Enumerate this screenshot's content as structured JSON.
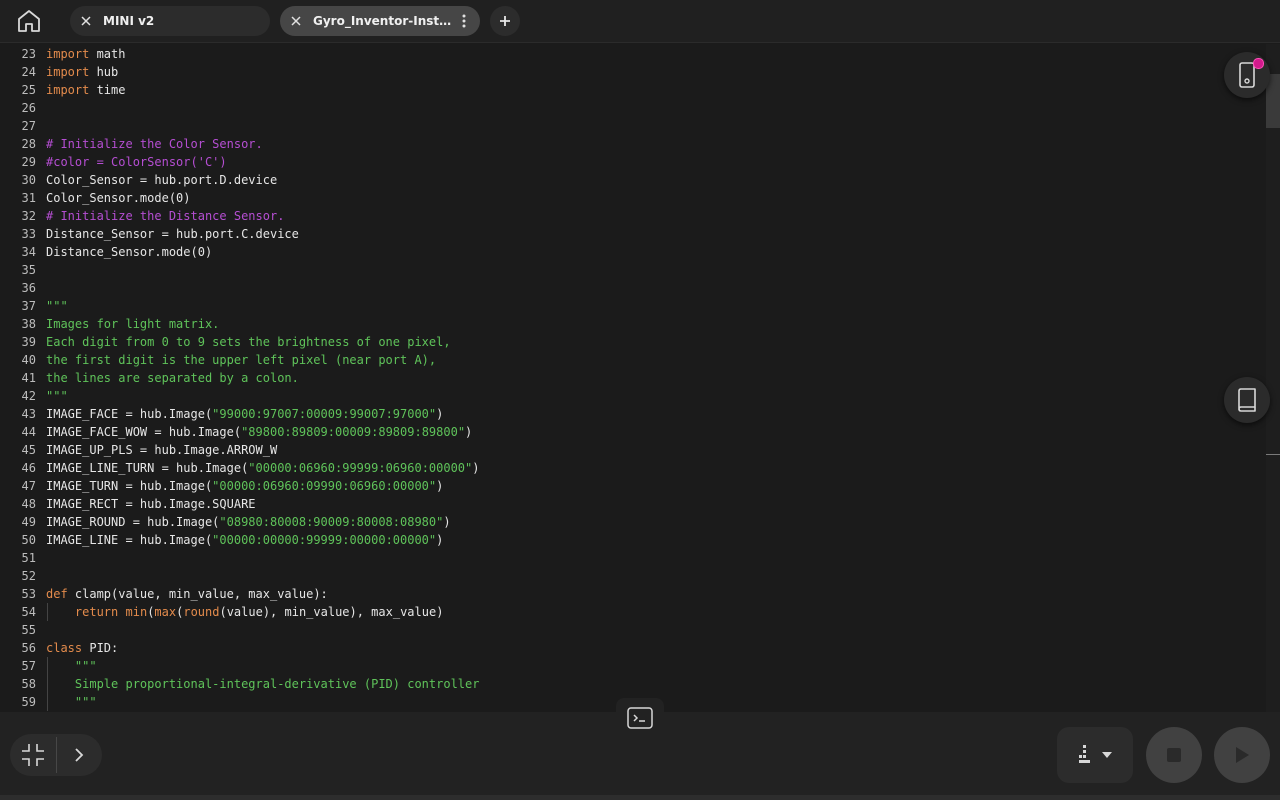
{
  "tabs": [
    {
      "label": "MINI v2",
      "active": false
    },
    {
      "label": "Gyro_Inventor-Instr...",
      "active": true
    }
  ],
  "code": {
    "lines": [
      {
        "n": "23",
        "tokens": [
          {
            "t": "k",
            "v": "import"
          },
          {
            "t": "n",
            "v": " math"
          }
        ]
      },
      {
        "n": "24",
        "tokens": [
          {
            "t": "k",
            "v": "import"
          },
          {
            "t": "n",
            "v": " hub"
          }
        ]
      },
      {
        "n": "25",
        "tokens": [
          {
            "t": "k",
            "v": "import"
          },
          {
            "t": "n",
            "v": " time"
          }
        ]
      },
      {
        "n": "26",
        "tokens": []
      },
      {
        "n": "27",
        "tokens": []
      },
      {
        "n": "28",
        "tokens": [
          {
            "t": "c",
            "v": "# Initialize the Color Sensor."
          }
        ]
      },
      {
        "n": "29",
        "tokens": [
          {
            "t": "c",
            "v": "#color = ColorSensor('C')"
          }
        ]
      },
      {
        "n": "30",
        "tokens": [
          {
            "t": "n",
            "v": "Color_Sensor = hub.port.D.device"
          }
        ]
      },
      {
        "n": "31",
        "tokens": [
          {
            "t": "n",
            "v": "Color_Sensor.mode(0)"
          }
        ]
      },
      {
        "n": "32",
        "tokens": [
          {
            "t": "c",
            "v": "# Initialize the Distance Sensor."
          }
        ]
      },
      {
        "n": "33",
        "tokens": [
          {
            "t": "n",
            "v": "Distance_Sensor = hub.port.C.device"
          }
        ]
      },
      {
        "n": "34",
        "tokens": [
          {
            "t": "n",
            "v": "Distance_Sensor.mode(0)"
          }
        ]
      },
      {
        "n": "35",
        "tokens": []
      },
      {
        "n": "36",
        "tokens": []
      },
      {
        "n": "37",
        "tokens": [
          {
            "t": "s",
            "v": "\"\"\""
          }
        ]
      },
      {
        "n": "38",
        "tokens": [
          {
            "t": "s",
            "v": "Images for light matrix."
          }
        ]
      },
      {
        "n": "39",
        "tokens": [
          {
            "t": "s",
            "v": "Each digit from 0 to 9 sets the brightness of one pixel,"
          }
        ]
      },
      {
        "n": "40",
        "tokens": [
          {
            "t": "s",
            "v": "the first digit is the upper left pixel (near port A),"
          }
        ]
      },
      {
        "n": "41",
        "tokens": [
          {
            "t": "s",
            "v": "the lines are separated by a colon."
          }
        ]
      },
      {
        "n": "42",
        "tokens": [
          {
            "t": "s",
            "v": "\"\"\""
          }
        ]
      },
      {
        "n": "43",
        "tokens": [
          {
            "t": "n",
            "v": "IMAGE_FACE = hub.Image("
          },
          {
            "t": "s",
            "v": "\"99000:97007:00009:99007:97000\""
          },
          {
            "t": "n",
            "v": ")"
          }
        ]
      },
      {
        "n": "44",
        "tokens": [
          {
            "t": "n",
            "v": "IMAGE_FACE_WOW = hub.Image("
          },
          {
            "t": "s",
            "v": "\"89800:89809:00009:89809:89800\""
          },
          {
            "t": "n",
            "v": ")"
          }
        ]
      },
      {
        "n": "45",
        "tokens": [
          {
            "t": "n",
            "v": "IMAGE_UP_PLS = hub.Image.ARROW_W"
          }
        ]
      },
      {
        "n": "46",
        "tokens": [
          {
            "t": "n",
            "v": "IMAGE_LINE_TURN = hub.Image("
          },
          {
            "t": "s",
            "v": "\"00000:06960:99999:06960:00000\""
          },
          {
            "t": "n",
            "v": ")"
          }
        ]
      },
      {
        "n": "47",
        "tokens": [
          {
            "t": "n",
            "v": "IMAGE_TURN = hub.Image("
          },
          {
            "t": "s",
            "v": "\"00000:06960:09990:06960:00000\""
          },
          {
            "t": "n",
            "v": ")"
          }
        ]
      },
      {
        "n": "48",
        "tokens": [
          {
            "t": "n",
            "v": "IMAGE_RECT = hub.Image.SQUARE"
          }
        ]
      },
      {
        "n": "49",
        "tokens": [
          {
            "t": "n",
            "v": "IMAGE_ROUND = hub.Image("
          },
          {
            "t": "s",
            "v": "\"08980:80008:90009:80008:08980\""
          },
          {
            "t": "n",
            "v": ")"
          }
        ]
      },
      {
        "n": "50",
        "tokens": [
          {
            "t": "n",
            "v": "IMAGE_LINE = hub.Image("
          },
          {
            "t": "s",
            "v": "\"00000:00000:99999:00000:00000\""
          },
          {
            "t": "n",
            "v": ")"
          }
        ]
      },
      {
        "n": "51",
        "tokens": []
      },
      {
        "n": "52",
        "tokens": []
      },
      {
        "n": "53",
        "tokens": [
          {
            "t": "k",
            "v": "def"
          },
          {
            "t": "n",
            "v": " clamp(value, min_value, max_value):"
          }
        ]
      },
      {
        "n": "54",
        "tokens": [
          {
            "t": "n",
            "v": "    "
          },
          {
            "t": "k",
            "v": "return"
          },
          {
            "t": "n",
            "v": " "
          },
          {
            "t": "k",
            "v": "min"
          },
          {
            "t": "n",
            "v": "("
          },
          {
            "t": "k",
            "v": "max"
          },
          {
            "t": "n",
            "v": "("
          },
          {
            "t": "k",
            "v": "round"
          },
          {
            "t": "n",
            "v": "(value), min_value), max_value)"
          }
        ]
      },
      {
        "n": "55",
        "tokens": []
      },
      {
        "n": "56",
        "tokens": [
          {
            "t": "k",
            "v": "class"
          },
          {
            "t": "n",
            "v": " PID:"
          }
        ]
      },
      {
        "n": "57",
        "tokens": [
          {
            "t": "s",
            "v": "    \"\"\""
          }
        ]
      },
      {
        "n": "58",
        "tokens": [
          {
            "t": "s",
            "v": "    Simple proportional-integral-derivative (PID) controller"
          }
        ]
      },
      {
        "n": "59",
        "tokens": [
          {
            "t": "s",
            "v": "    \"\"\""
          }
        ]
      }
    ]
  },
  "icons": {
    "home": "home-icon",
    "close": "close-icon",
    "more": "more-vertical-icon",
    "add": "plus-icon",
    "device": "device-icon",
    "help": "book-icon",
    "console": "terminal-icon",
    "collapse": "collapse-icon",
    "expand": "chevron-right-icon",
    "slot": "slot-icon",
    "stop": "stop-icon",
    "play": "play-icon"
  },
  "colors": {
    "keyword": "#e38b4c",
    "comment": "#b54ed2",
    "string": "#5fc35a",
    "notification": "#d21a8c"
  }
}
